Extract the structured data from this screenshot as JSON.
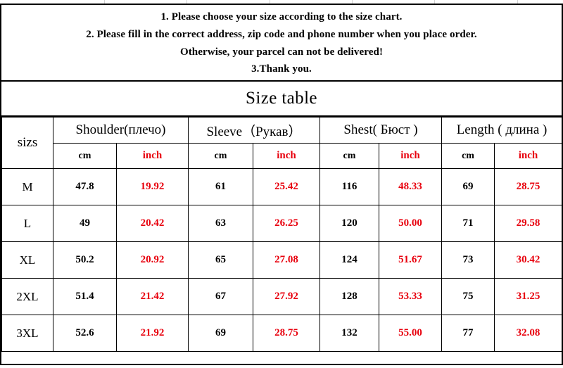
{
  "notes": {
    "lines": [
      "1. Please choose your size according to the size chart.",
      "2. Please fill in the correct address, zip code and phone number when you place order.",
      "Otherwise, your parcel can not be delivered!",
      "3.Thank you."
    ]
  },
  "title": "Size table",
  "table": {
    "size_header": "sizs",
    "groups": [
      {
        "label": "Shoulder(плечо)",
        "cm": "cm",
        "inch": "inch"
      },
      {
        "label": "Sleeve（Рукав）",
        "cm": "cm",
        "inch": "inch"
      },
      {
        "label": "Shest( Бюст )",
        "cm": "cm",
        "inch": "inch"
      },
      {
        "label": "Length ( длина )",
        "cm": "cm",
        "inch": "inch"
      }
    ],
    "rows": [
      {
        "size": "M",
        "shoulder_cm": "47.8",
        "shoulder_in": "19.92",
        "sleeve_cm": "61",
        "sleeve_in": "25.42",
        "chest_cm": "116",
        "chest_in": "48.33",
        "length_cm": "69",
        "length_in": "28.75"
      },
      {
        "size": "L",
        "shoulder_cm": "49",
        "shoulder_in": "20.42",
        "sleeve_cm": "63",
        "sleeve_in": "26.25",
        "chest_cm": "120",
        "chest_in": "50.00",
        "length_cm": "71",
        "length_in": "29.58"
      },
      {
        "size": "XL",
        "shoulder_cm": "50.2",
        "shoulder_in": "20.92",
        "sleeve_cm": "65",
        "sleeve_in": "27.08",
        "chest_cm": "124",
        "chest_in": "51.67",
        "length_cm": "73",
        "length_in": "30.42"
      },
      {
        "size": "2XL",
        "shoulder_cm": "51.4",
        "shoulder_in": "21.42",
        "sleeve_cm": "67",
        "sleeve_in": "27.92",
        "chest_cm": "128",
        "chest_in": "53.33",
        "length_cm": "75",
        "length_in": "31.25"
      },
      {
        "size": "3XL",
        "shoulder_cm": "52.6",
        "shoulder_in": "21.92",
        "sleeve_cm": "69",
        "sleeve_in": "28.75",
        "chest_cm": "132",
        "chest_in": "55.00",
        "length_cm": "77",
        "length_in": "32.08"
      }
    ]
  },
  "colors": {
    "inch_red": "#E8000D",
    "text_black": "#000000",
    "border": "#000000"
  }
}
